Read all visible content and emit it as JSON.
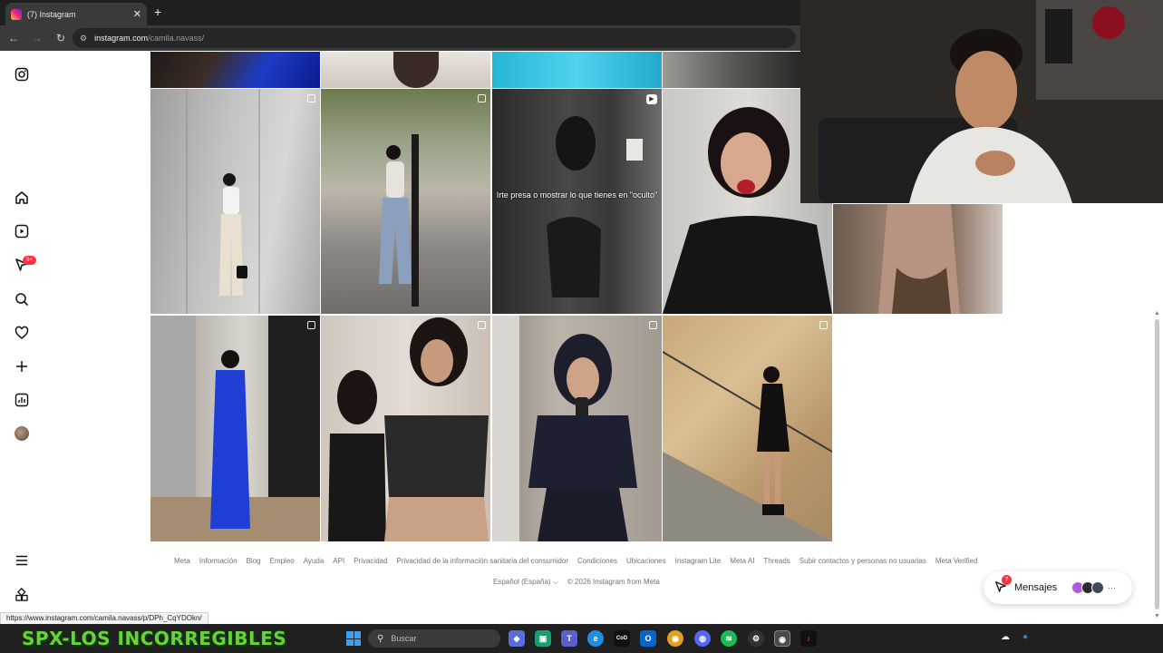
{
  "browser": {
    "tab_title": "(7) Instagram",
    "tab_close": "✕",
    "new_tab": "+",
    "back": "←",
    "forward": "→",
    "reload": "↻",
    "url_host": "instagram.com",
    "url_path": "/camila.navass/",
    "status_url": "https://www.instagram.com/camila.navass/p/DPh_CqYDOkn/"
  },
  "rail": {
    "notifications_badge": "9+"
  },
  "posts": {
    "reel_overlay_text": "Irte presa o mostrar lo que tienes en \"oculto\""
  },
  "footer": {
    "links": [
      "Meta",
      "Información",
      "Blog",
      "Empleo",
      "Ayuda",
      "API",
      "Privacidad",
      "Privacidad de la información sanitaria del consumidor",
      "Condiciones",
      "Ubicaciones",
      "Instagram Lite",
      "Meta AI",
      "Threads",
      "Subir contactos y personas no usuarias",
      "Meta Verified"
    ],
    "language": "Español (España) ⌵",
    "copyright": "© 2026 Instagram from Meta"
  },
  "messages": {
    "label": "Mensajes",
    "badge": "7",
    "more": "···"
  },
  "taskbar": {
    "brand": "SPX-LOS INCORREGIBLES",
    "search_placeholder": "Buscar"
  },
  "icons": {
    "instagram": "instagram-logo-icon",
    "home": "home-icon",
    "reels": "reels-icon",
    "messages": "messages-icon",
    "search": "search-icon",
    "notifications": "heart-icon",
    "create": "plus-icon",
    "dashboard": "dashboard-icon",
    "more": "menu-icon",
    "also_from_meta": "meta-apps-icon"
  },
  "colors": {
    "notification_red": "#ff3040",
    "link_gray": "#737373",
    "chrome_dark": "#1f1f1f"
  }
}
